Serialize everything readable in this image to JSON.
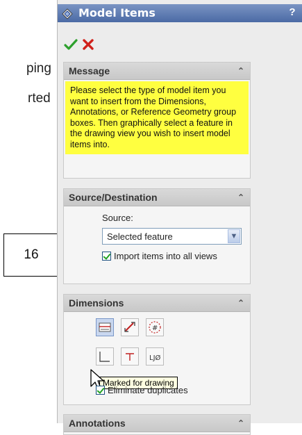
{
  "background_text": {
    "line1": "ping",
    "line2": "rted"
  },
  "callout": {
    "number": "16"
  },
  "property_manager": {
    "title": "Model Items",
    "help": "?",
    "ok_icon": "green-check-icon",
    "cancel_icon": "red-x-icon"
  },
  "message_group": {
    "title": "Message",
    "text": "Please select the type of model item you want to insert from the Dimensions, Annotations, or Reference Geometry group boxes. Then graphically select a feature in the drawing view you wish to insert model items into."
  },
  "source_group": {
    "title": "Source/Destination",
    "source_label": "Source:",
    "source_value": "Selected feature",
    "import_all_views_label": "Import items into all views",
    "import_all_views_checked": true
  },
  "dimensions_group": {
    "title": "Dimensions",
    "tooltip": "Marked for drawing",
    "eliminate_duplicates_label": "Eliminate duplicates",
    "eliminate_duplicates_checked": true
  },
  "annotations_group": {
    "title": "Annotations"
  },
  "colors": {
    "title_bar": "#4b6aa5",
    "message_bg": "#ffff40",
    "accent_check": "#21a121"
  }
}
